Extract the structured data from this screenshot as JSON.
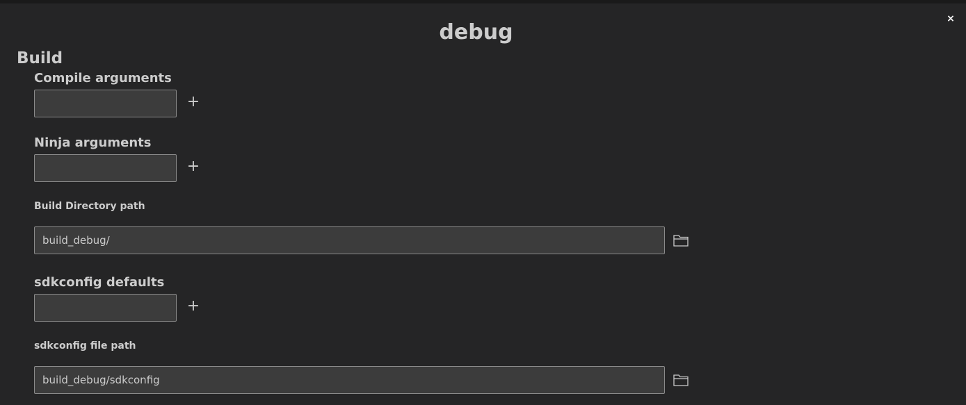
{
  "dialog": {
    "title": "debug",
    "close_glyph": "×"
  },
  "section": {
    "title": "Build"
  },
  "fields": {
    "compile_arguments": {
      "label": "Compile arguments",
      "value": "",
      "add_glyph": "+"
    },
    "ninja_arguments": {
      "label": "Ninja arguments",
      "value": "",
      "add_glyph": "+"
    },
    "build_directory_path": {
      "label": "Build Directory path",
      "value": "build_debug/",
      "browse_icon": "folder-icon"
    },
    "sdkconfig_defaults": {
      "label": "sdkconfig defaults",
      "value": "",
      "add_glyph": "+"
    },
    "sdkconfig_file_path": {
      "label": "sdkconfig file path",
      "value": "build_debug/sdkconfig",
      "browse_icon": "folder-icon"
    }
  },
  "colors": {
    "background": "#252526",
    "input_background": "#3c3c3c",
    "input_border": "#8a8a8a",
    "text": "#cccccc"
  }
}
